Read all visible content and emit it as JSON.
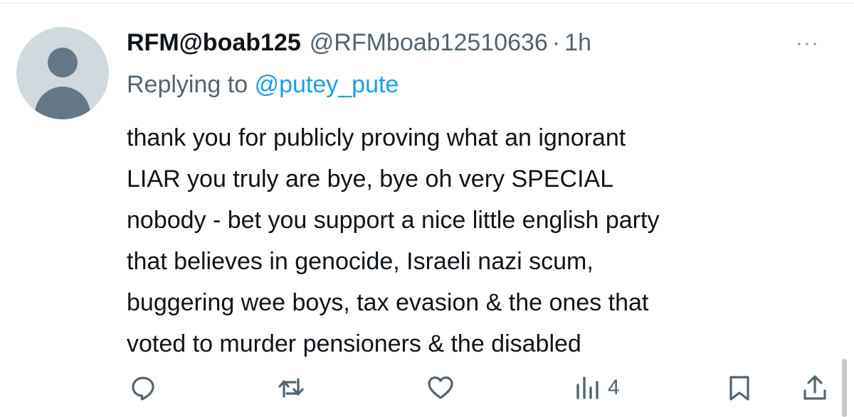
{
  "tweet": {
    "display_name": "RFM@boab125",
    "handle": "@RFMboab12510636",
    "separator": "·",
    "time": "1h",
    "more_icon": "···",
    "replying_prefix": "Replying to",
    "replying_to": "@putey_pute",
    "text_lines": [
      "thank you for publicly proving what an ignorant",
      "LIAR you truly are bye, bye oh very SPECIAL",
      "nobody - bet you support a nice little english party",
      "that believes in genocide, Israeli nazi scum,",
      "buggering wee boys, tax evasion & the ones that",
      "voted to murder pensioners & the disabled"
    ]
  },
  "actions": {
    "reply_icon": "reply-icon",
    "retweet_icon": "retweet-icon",
    "like_icon": "heart-icon",
    "views_icon": "views-chart-icon",
    "views_count": "4",
    "bookmark_icon": "bookmark-icon",
    "share_icon": "share-icon"
  },
  "colors": {
    "text": "#0f1419",
    "secondary": "#536471",
    "link": "#1d9bf0",
    "avatar_bg": "#cfd9de",
    "avatar_fg": "#657786"
  }
}
